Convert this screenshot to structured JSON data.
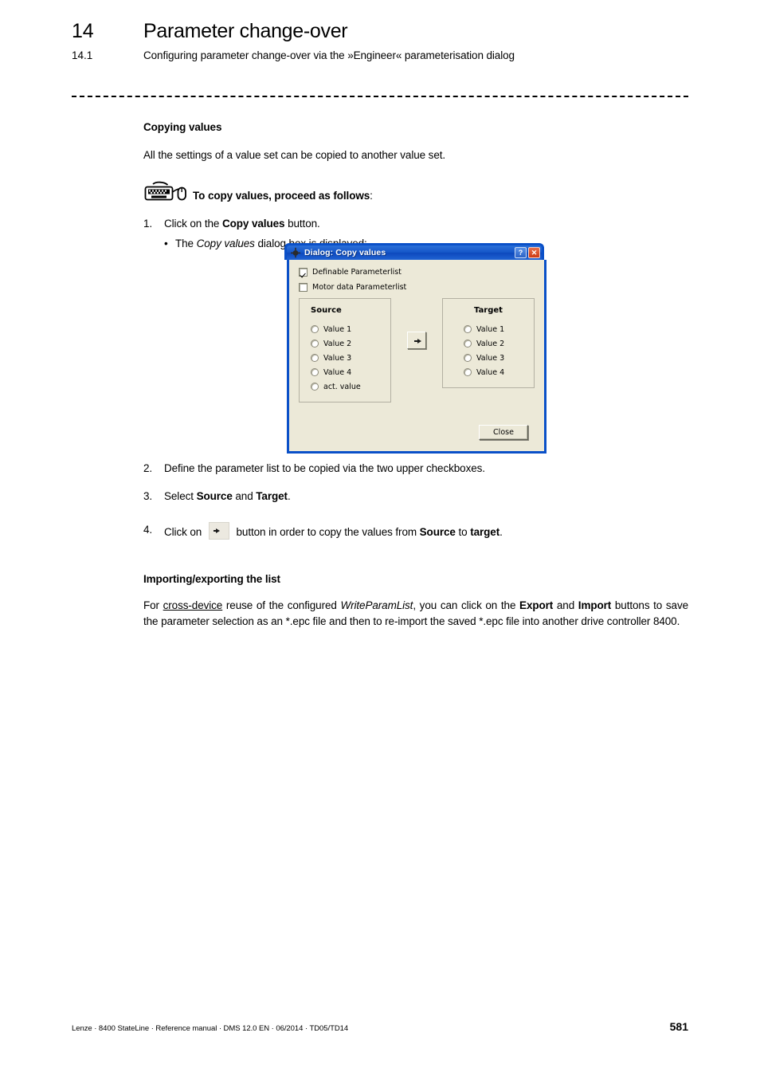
{
  "header": {
    "chapter_number": "14",
    "chapter_title": "Parameter change-over",
    "section_number": "14.1",
    "section_title": "Configuring parameter change-over via the »Engineer« parameterisation dialog"
  },
  "main": {
    "copying_heading": "Copying values",
    "copying_intro": "All the settings of a value set can be copied to another value set.",
    "callout": {
      "icon": "keyboard-mouse-icon",
      "label_bold": "To copy values, proceed as follows",
      "label_colon": ":"
    },
    "steps": [
      {
        "num": "1.",
        "pre": "Click on the ",
        "bold": "Copy values",
        "post": " button."
      },
      {
        "num": "2.",
        "text": "Define the parameter list to be copied via the two upper checkboxes."
      },
      {
        "num": "3.",
        "pre": "Select ",
        "bold": "Source",
        "mid": " and ",
        "bold2": "Target",
        "post": "."
      },
      {
        "num": "4.",
        "pre": "Click on ",
        "post1": " button in order to copy the values from ",
        "bold": "Source",
        "mid": " to ",
        "bold2": "target",
        "post": "."
      }
    ],
    "sub_bullet": {
      "dot": "•",
      "pre": "The ",
      "italic": "Copy values",
      "post": " dialog box is displayed:"
    },
    "import_export": {
      "heading": "Importing/exporting the list",
      "p_part1": "For ",
      "p_underlined": "cross-device",
      "p_part2": " reuse of the configured ",
      "p_italic": "WriteParamList",
      "p_part3": ", you can click on the ",
      "p_bold1": "Export",
      "p_part4": " and ",
      "p_bold2": "Import",
      "p_part5": " buttons to save the parameter selection as an *.epc file and then to re-import the saved *.epc file into another drive controller 8400."
    }
  },
  "dialog": {
    "title": "Dialog: Copy values",
    "title_icon": "application-icon",
    "help_button": "?",
    "close_button": "✕",
    "checkboxes": [
      {
        "label": "Definable Parameterlist",
        "checked": true
      },
      {
        "label": "Motor data Parameterlist",
        "checked": false
      }
    ],
    "source_group": {
      "title": "Source",
      "options": [
        "Value 1",
        "Value 2",
        "Value 3",
        "Value 4",
        "act. value"
      ],
      "selected": null
    },
    "target_group": {
      "title": "Target",
      "options": [
        "Value 1",
        "Value 2",
        "Value 3",
        "Value 4"
      ],
      "selected": null
    },
    "copy_arrow_button": "arrow-right-icon",
    "close_label": "Close",
    "colors": {
      "titlebar": "#1556c8",
      "body": "#ece9d8",
      "border": "#0a50c8",
      "close_button": "#cc3a14"
    }
  },
  "footer": {
    "text": "Lenze · 8400 StateLine · Reference manual · DMS 12.0 EN · 06/2014 · TD05/TD14",
    "page_number": "581"
  }
}
